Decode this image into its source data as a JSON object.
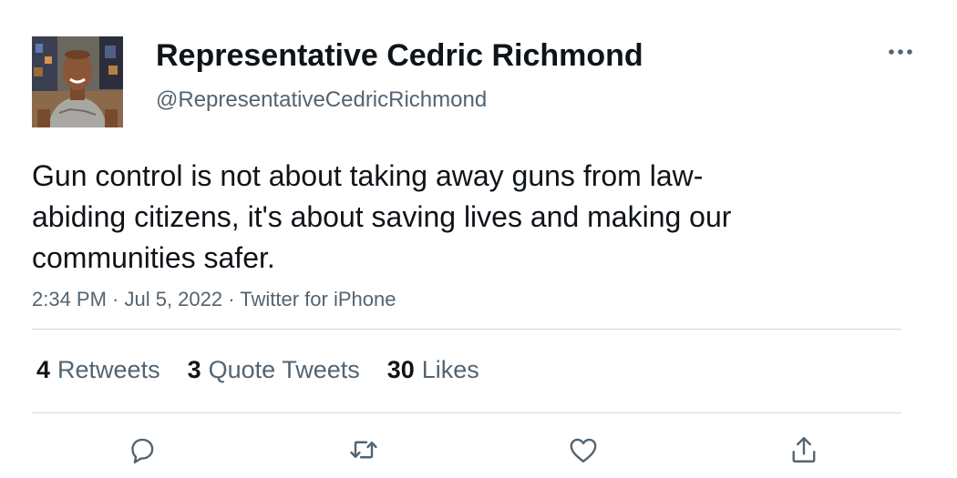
{
  "author": {
    "display_name": "Representative Cedric Richmond",
    "handle": "@RepresentativeCedricRichmond",
    "avatar_icon": "profile-photo"
  },
  "tweet": {
    "text": "Gun control is not about taking away guns from law-abiding citizens, it's about saving lives and making our communities safer.",
    "meta": "2:34 PM · Jul 5, 2022 · Twitter for iPhone"
  },
  "stats": {
    "retweets": {
      "count": "4",
      "label": "Retweets"
    },
    "quote_tweets": {
      "count": "3",
      "label": "Quote Tweets"
    },
    "likes": {
      "count": "30",
      "label": "Likes"
    }
  },
  "actions": {
    "reply_icon": "reply-icon",
    "retweet_icon": "retweet-icon",
    "like_icon": "heart-icon",
    "share_icon": "share-icon"
  },
  "colors": {
    "text_primary": "#0f1419",
    "text_secondary": "#536471",
    "divider": "#cfd9de",
    "icon": "#536471"
  }
}
